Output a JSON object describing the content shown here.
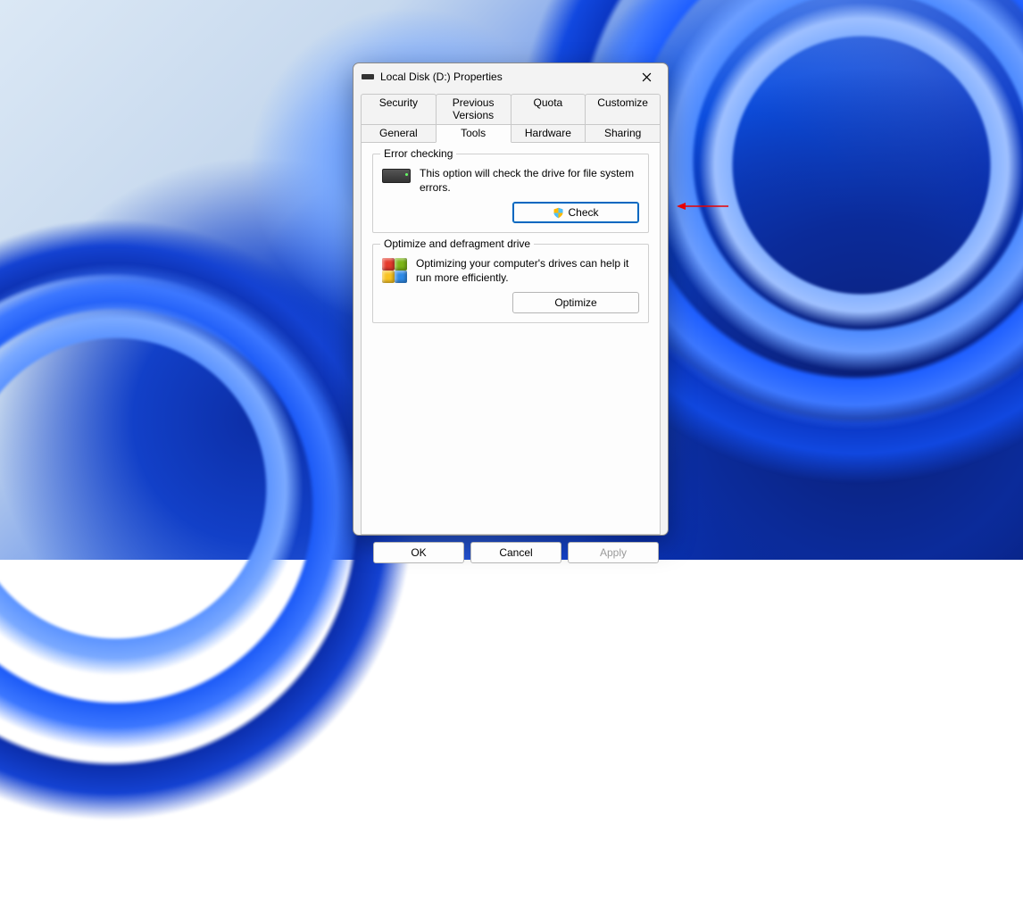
{
  "window": {
    "title": "Local Disk (D:) Properties"
  },
  "tabs": {
    "row1": [
      "Security",
      "Previous Versions",
      "Quota",
      "Customize"
    ],
    "row2": [
      "General",
      "Tools",
      "Hardware",
      "Sharing"
    ],
    "active": "Tools"
  },
  "error_checking": {
    "legend": "Error checking",
    "description": "This option will check the drive for file system errors.",
    "button": "Check"
  },
  "optimize": {
    "legend": "Optimize and defragment drive",
    "description": "Optimizing your computer's drives can help it run more efficiently.",
    "button": "Optimize"
  },
  "footer": {
    "ok": "OK",
    "cancel": "Cancel",
    "apply": "Apply"
  }
}
